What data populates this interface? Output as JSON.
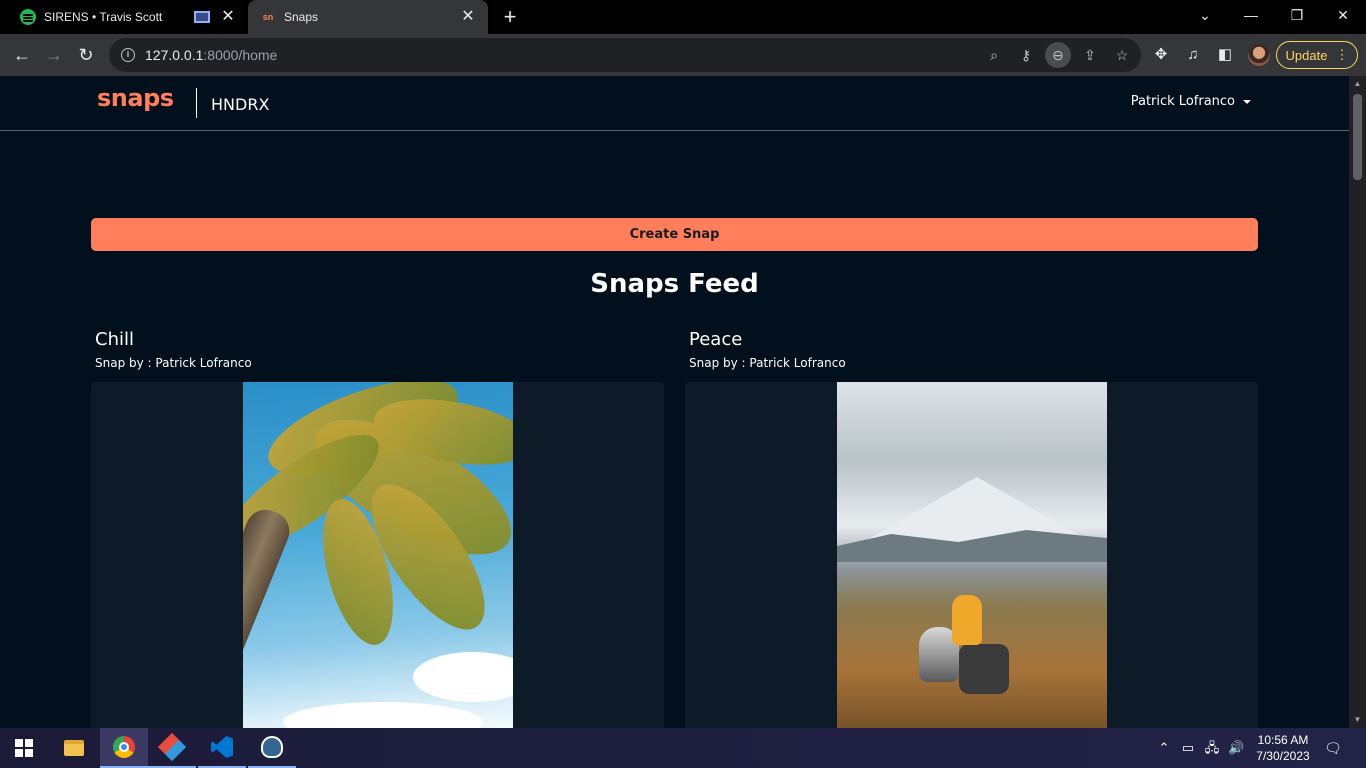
{
  "browser": {
    "tabs": [
      {
        "title": "SIRENS • Travis Scott",
        "active": false,
        "favicon": "spotify-icon"
      },
      {
        "title": "Snaps",
        "active": true,
        "favicon": "snaps-favicon"
      }
    ],
    "url": {
      "host": "127.0.0.1",
      "rest": ":8000/home"
    },
    "update_label": "Update"
  },
  "site": {
    "brand": "snaps",
    "brand_sub": "HNDRX",
    "user_name": "Patrick Lofranco",
    "accent_color": "#ff7f5c",
    "background_color": "#020f1c"
  },
  "page": {
    "create_button": "Create Snap",
    "feed_title": "Snaps Feed",
    "snaps": [
      {
        "title": "Chill",
        "byline": "Snap by : Patrick Lofranco",
        "image": "palm-tree-photo"
      },
      {
        "title": "Peace",
        "byline": "Snap by : Patrick Lofranco",
        "image": "mountain-dog-photo"
      }
    ]
  },
  "taskbar": {
    "time": "10:56 AM",
    "date": "7/30/2023",
    "apps": [
      "start",
      "file-explorer",
      "chrome",
      "gitkraken",
      "vscode",
      "pgadmin"
    ]
  }
}
